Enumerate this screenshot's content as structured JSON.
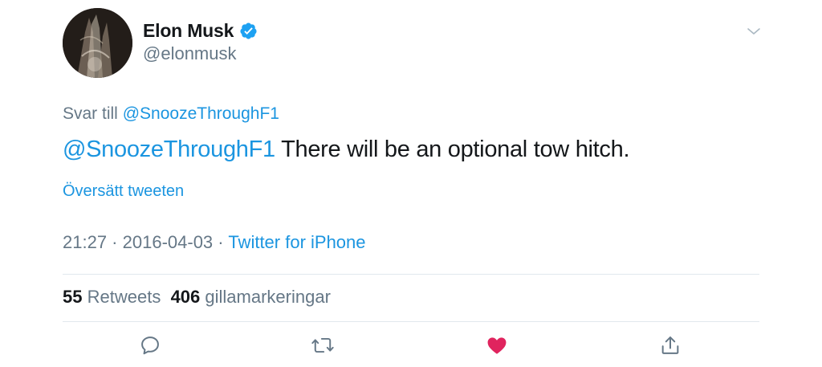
{
  "author": {
    "display_name": "Elon Musk",
    "handle": "@elonmusk",
    "verified": true,
    "avatar_icon": "avatar-photo"
  },
  "tweet": {
    "reply_prefix": "Svar till",
    "reply_to": "@SnoozeThroughF1",
    "mention": "@SnoozeThroughF1",
    "text": " There will be an optional tow hitch.",
    "translate_label": "Översätt tweeten"
  },
  "meta": {
    "time": "21:27",
    "separator1": " · ",
    "date": "2016-04-03",
    "separator2": " · ",
    "source": "Twitter for iPhone"
  },
  "stats": {
    "retweets_count": "55",
    "retweets_label": "Retweets",
    "likes_count": "406",
    "likes_label": "gillamarkeringar"
  },
  "actions": [
    {
      "name": "reply-icon"
    },
    {
      "name": "retweet-icon"
    },
    {
      "name": "like-icon",
      "active": true
    },
    {
      "name": "share-icon"
    }
  ],
  "colors": {
    "link": "#1b95e0",
    "secondary": "#657786",
    "primary": "#14171a",
    "like_active": "#e0245e",
    "divider": "#e1e8ed"
  }
}
